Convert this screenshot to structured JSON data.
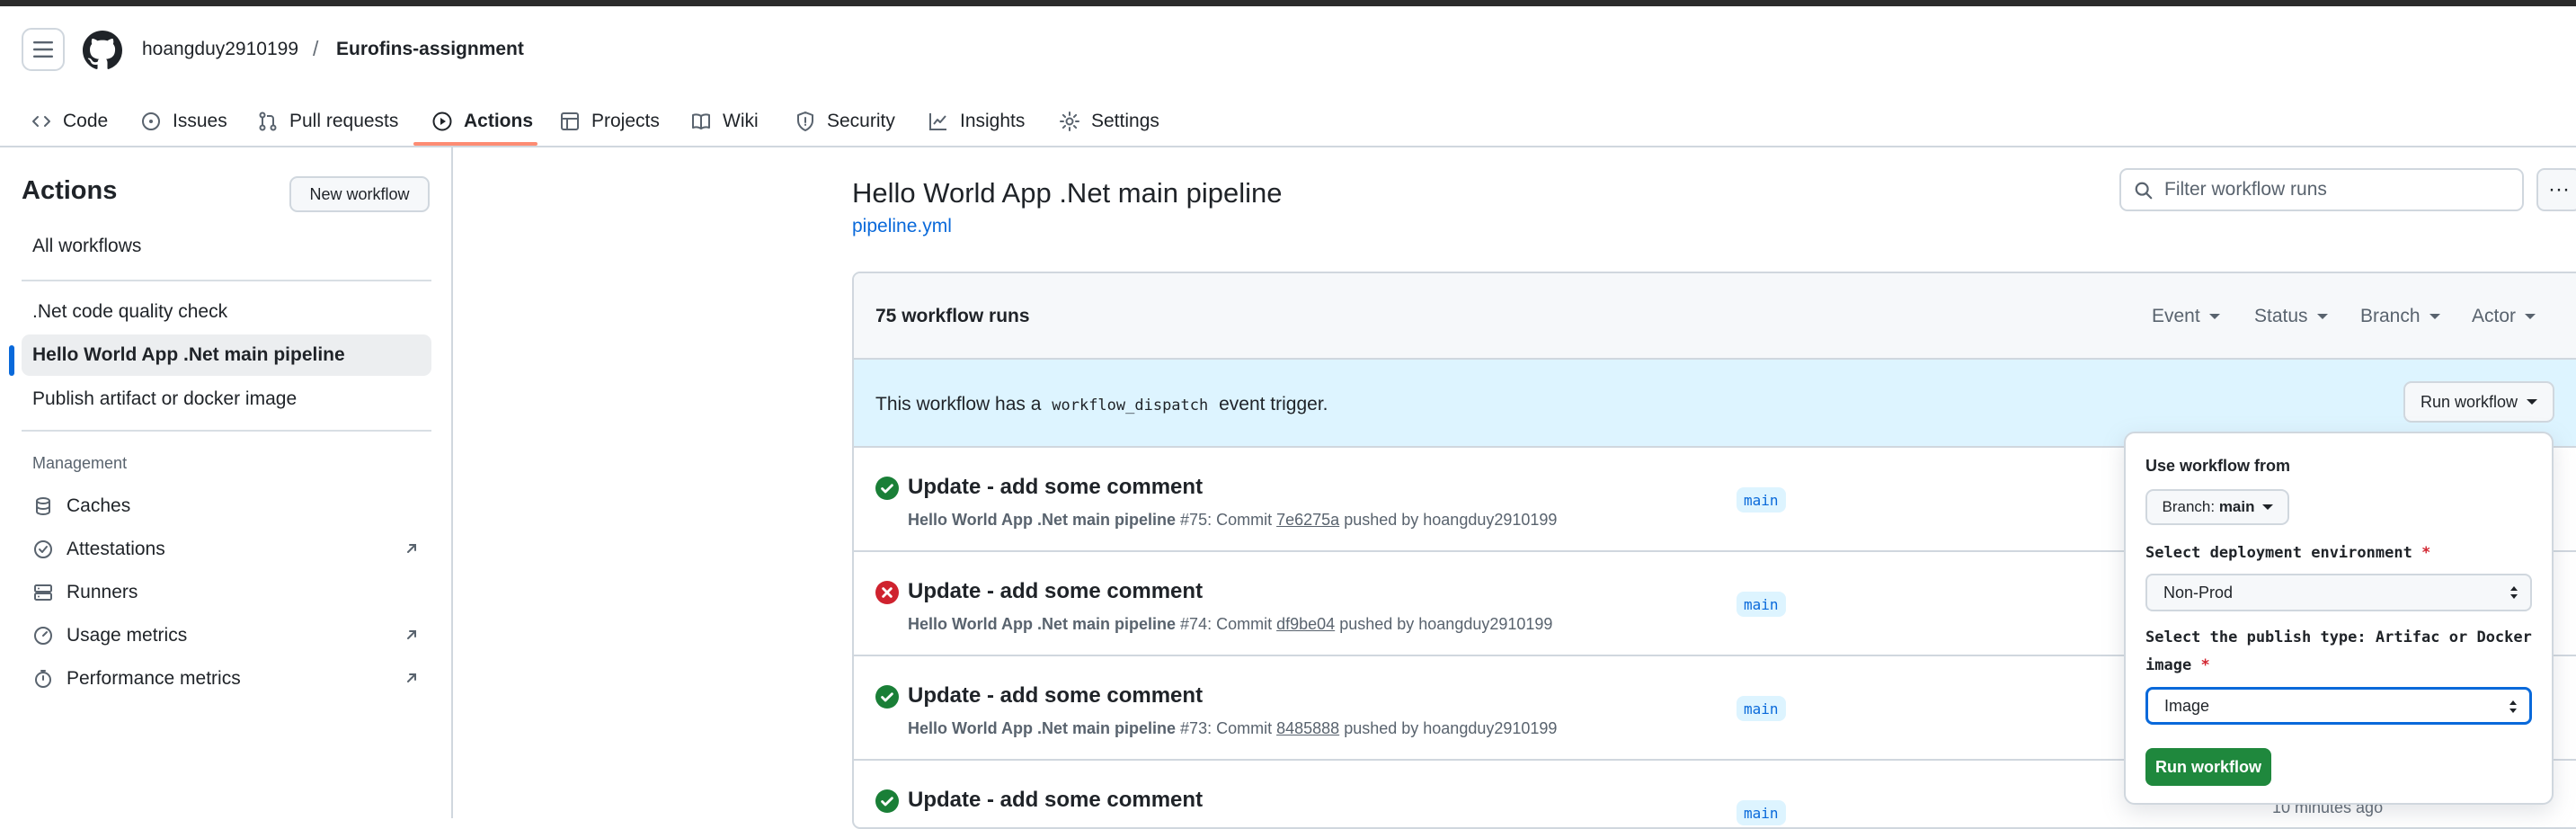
{
  "header": {
    "owner": "hoangduy2910199",
    "separator": "/",
    "repo": "Eurofins-assignment"
  },
  "tabs": [
    {
      "label": "Code"
    },
    {
      "label": "Issues"
    },
    {
      "label": "Pull requests"
    },
    {
      "label": "Actions"
    },
    {
      "label": "Projects"
    },
    {
      "label": "Wiki"
    },
    {
      "label": "Security"
    },
    {
      "label": "Insights"
    },
    {
      "label": "Settings"
    }
  ],
  "sidebar": {
    "title": "Actions",
    "new_workflow": "New workflow",
    "all_workflows": "All workflows",
    "workflows": [
      ".Net code quality check",
      "Hello World App .Net main pipeline",
      "Publish artifact or docker image"
    ],
    "management_label": "Management",
    "management": [
      "Caches",
      "Attestations",
      "Runners",
      "Usage metrics",
      "Performance metrics"
    ]
  },
  "main": {
    "title": "Hello World App .Net main pipeline",
    "file_link": "pipeline.yml",
    "filter_placeholder": "Filter workflow runs",
    "more": "···",
    "runs_count": "75 workflow runs",
    "filters": [
      "Event",
      "Status",
      "Branch",
      "Actor"
    ],
    "banner": {
      "pre": "This workflow has a",
      "code": "workflow_dispatch",
      "post": "event trigger."
    },
    "run_workflow_button": "Run workflow",
    "runs": [
      {
        "title": "Update - add some comment",
        "workflow": "Hello World App .Net main pipeline",
        "meta": "#75: Commit",
        "commit": "7e6275a",
        "by": "pushed by hoangduy2910199",
        "branch": "main",
        "status": "success"
      },
      {
        "title": "Update - add some comment",
        "workflow": "Hello World App .Net main pipeline",
        "meta": "#74: Commit",
        "commit": "df9be04",
        "by": "pushed by hoangduy2910199",
        "branch": "main",
        "status": "failure"
      },
      {
        "title": "Update - add some comment",
        "workflow": "Hello World App .Net main pipeline",
        "meta": "#73: Commit",
        "commit": "8485888",
        "by": "pushed by hoangduy2910199",
        "branch": "main",
        "status": "success"
      },
      {
        "title": "Update - add some comment",
        "branch": "main",
        "status": "success",
        "age": "10 minutes ago"
      }
    ]
  },
  "popover": {
    "use_from": "Use workflow from",
    "branch_prefix": "Branch:",
    "branch": "main",
    "env_label": "Select deployment environment",
    "env_value": "Non-Prod",
    "type_label_1": "Select the publish type: Artifac or Docker",
    "type_label_2": "image",
    "type_value": "Image",
    "required": "*",
    "submit": "Run workflow"
  },
  "colors": {
    "success": "#1a7f37",
    "failure": "#cf222e",
    "accent": "#0969da",
    "tab_underline": "#fd8c73",
    "primary_button": "#1f883d"
  }
}
